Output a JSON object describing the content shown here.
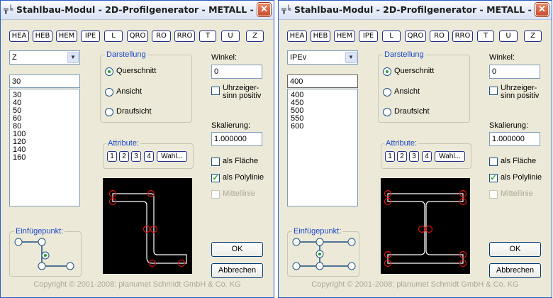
{
  "windows": [
    {
      "title": "Stahlbau-Modul - 2D-Profilgenerator - METALL -",
      "title_icon": "╦╘",
      "close_symbol": "✕",
      "profile_buttons": [
        "HEA",
        "HEB",
        "HEM",
        "IPE",
        "L",
        "QRO",
        "RO",
        "RRO",
        "T",
        "U",
        "Z"
      ],
      "profile_type": "Z",
      "size_value": "30",
      "sizes": [
        "30",
        "40",
        "50",
        "60",
        "80",
        "100",
        "120",
        "140",
        "160"
      ],
      "darstellung": {
        "label": "Darstellung",
        "options": [
          "Querschnitt",
          "Ansicht",
          "Draufsicht"
        ],
        "selected": "Querschnitt"
      },
      "winkel": {
        "label": "Winkel:",
        "value": "0"
      },
      "uhrzeiger": {
        "line1": "Uhrzeiger-",
        "line2": "sinn positiv",
        "checked": false
      },
      "skalierung": {
        "label": "Skalierung:",
        "value": "1.000000"
      },
      "attribute": {
        "label": "Attribute:",
        "buttons": [
          "1",
          "2",
          "3",
          "4",
          "Wahl..."
        ]
      },
      "als_flaeche": {
        "label": "als Fläche",
        "checked": false
      },
      "als_polylinie": {
        "label": "als Polylinie",
        "checked": true
      },
      "mittellinie": {
        "label": "Mittellinie",
        "checked": false,
        "disabled": true
      },
      "einfuegepunkt": {
        "label": "Einfügepunkt:"
      },
      "ok_label": "OK",
      "cancel_label": "Abbrechen",
      "copyright": "Copyright © 2001-2008: planumet Schmidt GmbH & Co. KG",
      "preview_shape": "z-profile"
    },
    {
      "title": "Stahlbau-Modul - 2D-Profilgenerator - METALL -",
      "title_icon": "╦╘",
      "close_symbol": "✕",
      "profile_buttons": [
        "HEA",
        "HEB",
        "HEM",
        "IPE",
        "L",
        "QRO",
        "RO",
        "RRO",
        "T",
        "U",
        "Z"
      ],
      "profile_type": "IPEv",
      "size_value": "400",
      "sizes": [
        "400",
        "450",
        "500",
        "550",
        "600"
      ],
      "darstellung": {
        "label": "Darstellung",
        "options": [
          "Querschnitt",
          "Ansicht",
          "Draufsicht"
        ],
        "selected": "Querschnitt"
      },
      "winkel": {
        "label": "Winkel:",
        "value": "0"
      },
      "uhrzeiger": {
        "line1": "Uhrzeiger-",
        "line2": "sinn positiv",
        "checked": false
      },
      "skalierung": {
        "label": "Skalierung:",
        "value": "1.000000"
      },
      "attribute": {
        "label": "Attribute:",
        "buttons": [
          "1",
          "2",
          "3",
          "4",
          "Wahl..."
        ]
      },
      "als_flaeche": {
        "label": "als Fläche",
        "checked": false
      },
      "als_polylinie": {
        "label": "als Polylinie",
        "checked": true
      },
      "mittellinie": {
        "label": "Mittellinie",
        "checked": false,
        "disabled": true
      },
      "einfuegepunkt": {
        "label": "Einfügepunkt:"
      },
      "ok_label": "OK",
      "cancel_label": "Abbrechen",
      "copyright": "Copyright © 2001-2008: planumet Schmidt GmbH & Co. KG",
      "preview_shape": "i-profile"
    }
  ],
  "colors": {
    "group_label": "#1a48c8",
    "radio_dot": "#21a121",
    "preview_bg": "#000000",
    "preview_line": "#ffffff",
    "preview_marker": "#e01010",
    "disabled_text": "#aca899"
  }
}
